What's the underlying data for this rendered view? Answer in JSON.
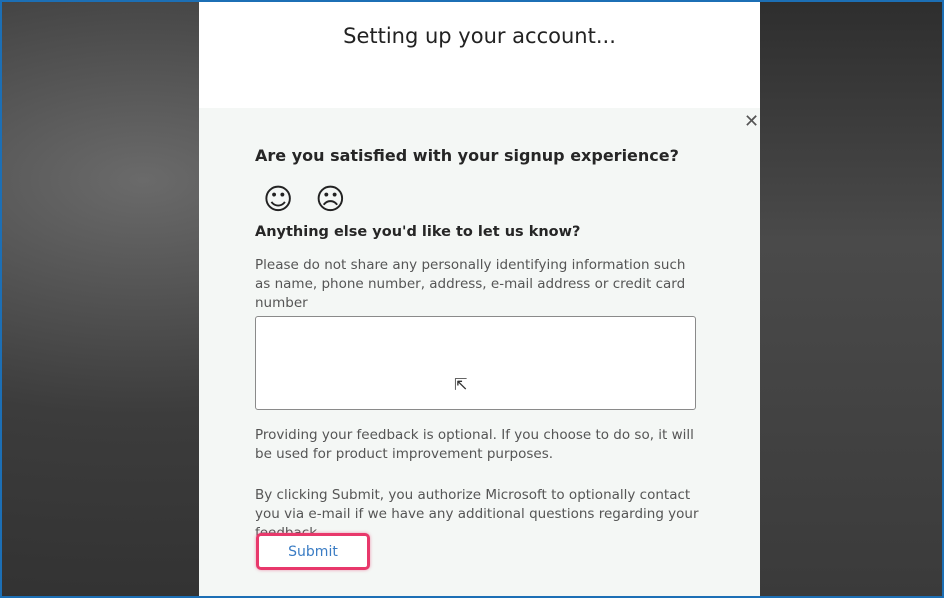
{
  "header": {
    "title": "Setting up your account..."
  },
  "feedback": {
    "question1": "Are you satisfied with your signup experience?",
    "smile": "☺",
    "frown": "☹",
    "question2": "Anything else you'd like to let us know?",
    "privacy_note": "Please do not share any personally identifying information such as name, phone number, address, e-mail address or credit card number",
    "textarea_value": "",
    "optional_note": "Providing your feedback is optional. If you choose to do so, it will be used for product improvement purposes.",
    "consent_note": "By clicking Submit, you authorize Microsoft to optionally contact you via e-mail if we have any additional questions regarding your feedback.",
    "submit_label": "Submit",
    "close": "✕"
  },
  "colors": {
    "highlight": "#e8386b",
    "frame": "#1c6fb5",
    "link": "#3a7cc4"
  }
}
